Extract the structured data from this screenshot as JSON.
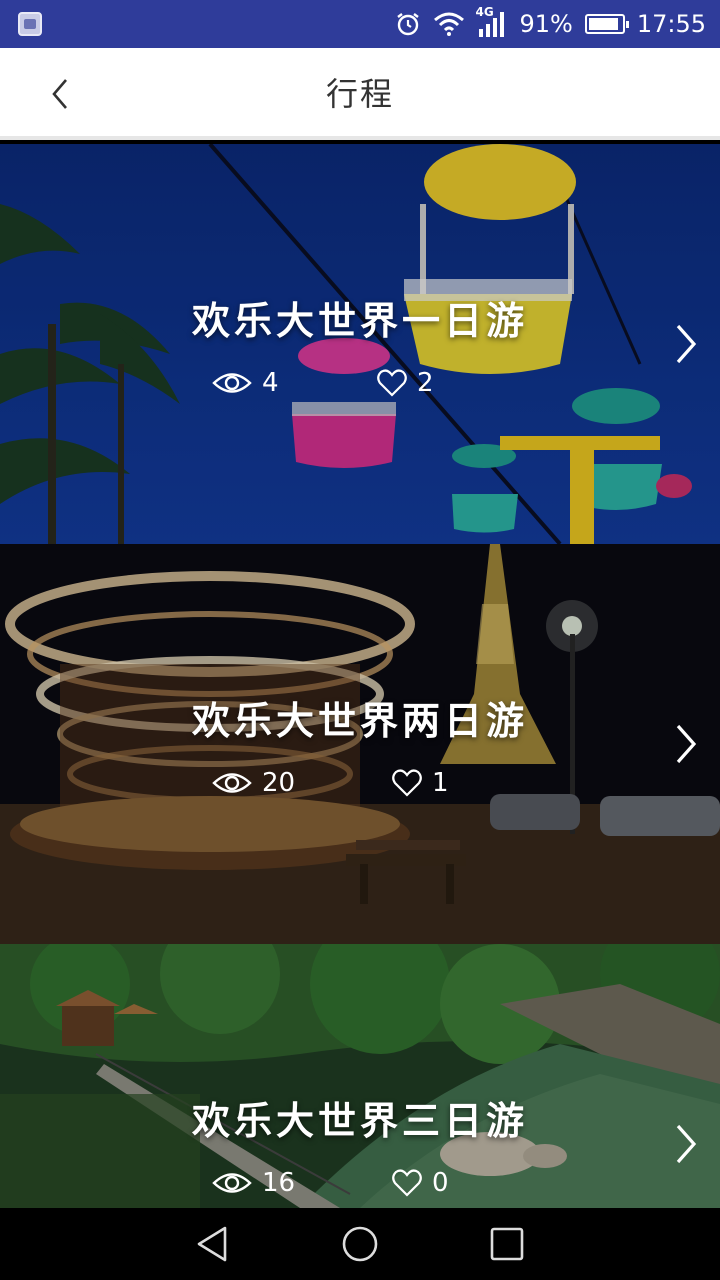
{
  "status_bar": {
    "network": "4G",
    "battery": "91%",
    "battery_level": 0.91,
    "time": "17:55",
    "icons": [
      "app-notification-icon",
      "alarm-icon",
      "wifi-icon",
      "signal-icon",
      "battery-icon"
    ]
  },
  "header": {
    "title": "行程",
    "back_icon": "chevron-left-icon"
  },
  "trips": [
    {
      "title": "欢乐大世界一日游",
      "views": "4",
      "likes": "2"
    },
    {
      "title": "欢乐大世界两日游",
      "views": "20",
      "likes": "1"
    },
    {
      "title": "欢乐大世界三日游",
      "views": "16",
      "likes": "0"
    }
  ],
  "nav_bar": {
    "icons": [
      "back-triangle-icon",
      "home-circle-icon",
      "recents-square-icon"
    ]
  }
}
